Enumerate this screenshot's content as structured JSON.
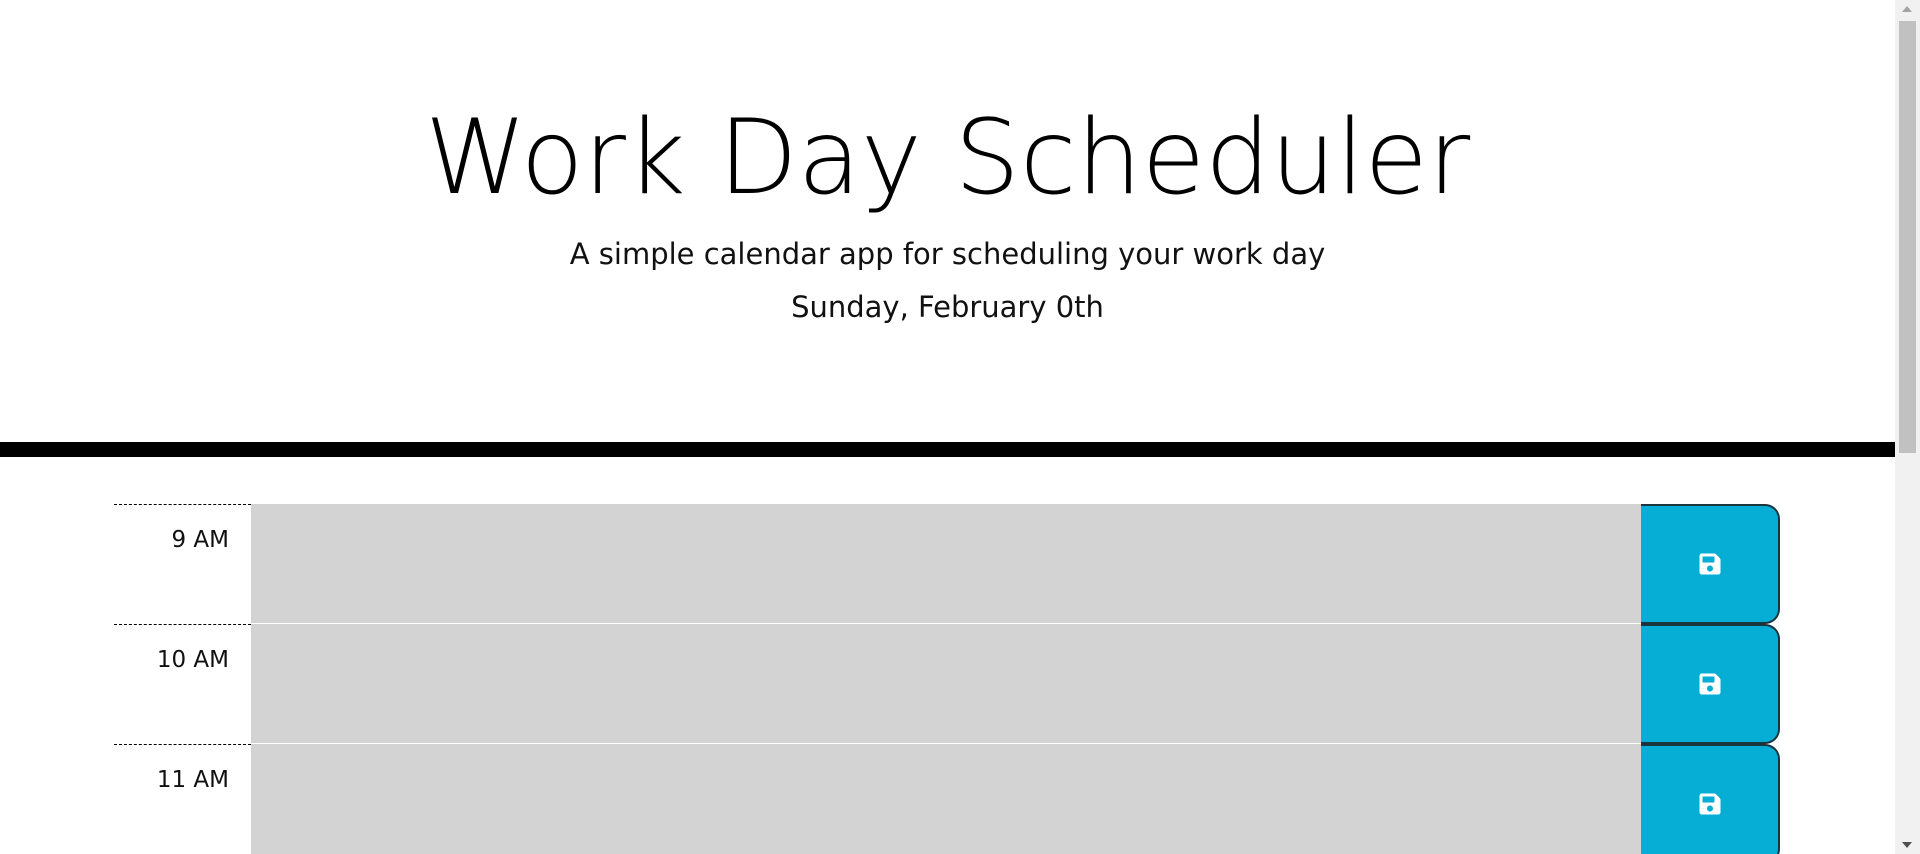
{
  "header": {
    "title": "Work Day Scheduler",
    "lead": "A simple calendar app for scheduling your work day",
    "current_day": "Sunday, February 0th"
  },
  "time_blocks": [
    {
      "hour": "9 AM",
      "description": "",
      "save_icon": "floppy-disk-icon"
    },
    {
      "hour": "10 AM",
      "description": "",
      "save_icon": "floppy-disk-icon"
    },
    {
      "hour": "11 AM",
      "description": "",
      "save_icon": "floppy-disk-icon"
    }
  ],
  "colors": {
    "save_button": "#06aed5",
    "past_block": "#d3d3d3",
    "divider": "#000000"
  }
}
